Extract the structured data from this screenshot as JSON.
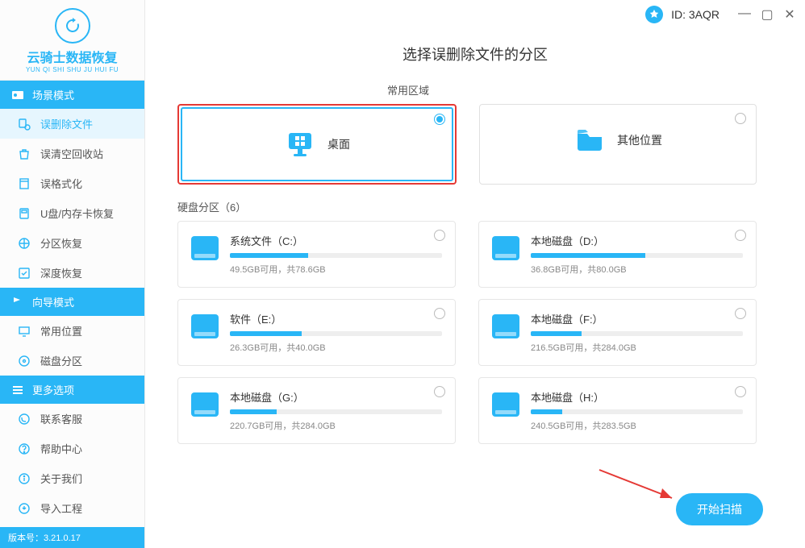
{
  "header": {
    "id_label": "ID: 3AQR"
  },
  "logo": {
    "title": "云骑士数据恢复",
    "subtitle": "YUN QI SHI SHU JU HUI FU"
  },
  "sidebar": {
    "section1": "场景模式",
    "items1": [
      "误删除文件",
      "误清空回收站",
      "误格式化",
      "U盘/内存卡恢复",
      "分区恢复",
      "深度恢复"
    ],
    "section2": "向导模式",
    "items2": [
      "常用位置",
      "磁盘分区"
    ],
    "section3": "更多选项",
    "items3": [
      "联系客服",
      "帮助中心",
      "关于我们",
      "导入工程"
    ]
  },
  "version": "版本号：3.21.0.17",
  "page": {
    "title": "选择误删除文件的分区",
    "common_label": "常用区域",
    "desktop": "桌面",
    "other_loc": "其他位置",
    "disk_label": "硬盘分区（6）",
    "scan": "开始扫描"
  },
  "disks": [
    {
      "name": "系统文件（C:）",
      "detail": "49.5GB可用，共78.6GB",
      "fill": 37
    },
    {
      "name": "本地磁盘（D:）",
      "detail": "36.8GB可用，共80.0GB",
      "fill": 54
    },
    {
      "name": "软件（E:）",
      "detail": "26.3GB可用，共40.0GB",
      "fill": 34
    },
    {
      "name": "本地磁盘（F:）",
      "detail": "216.5GB可用，共284.0GB",
      "fill": 24
    },
    {
      "name": "本地磁盘（G:）",
      "detail": "220.7GB可用，共284.0GB",
      "fill": 22
    },
    {
      "name": "本地磁盘（H:）",
      "detail": "240.5GB可用，共283.5GB",
      "fill": 15
    }
  ]
}
